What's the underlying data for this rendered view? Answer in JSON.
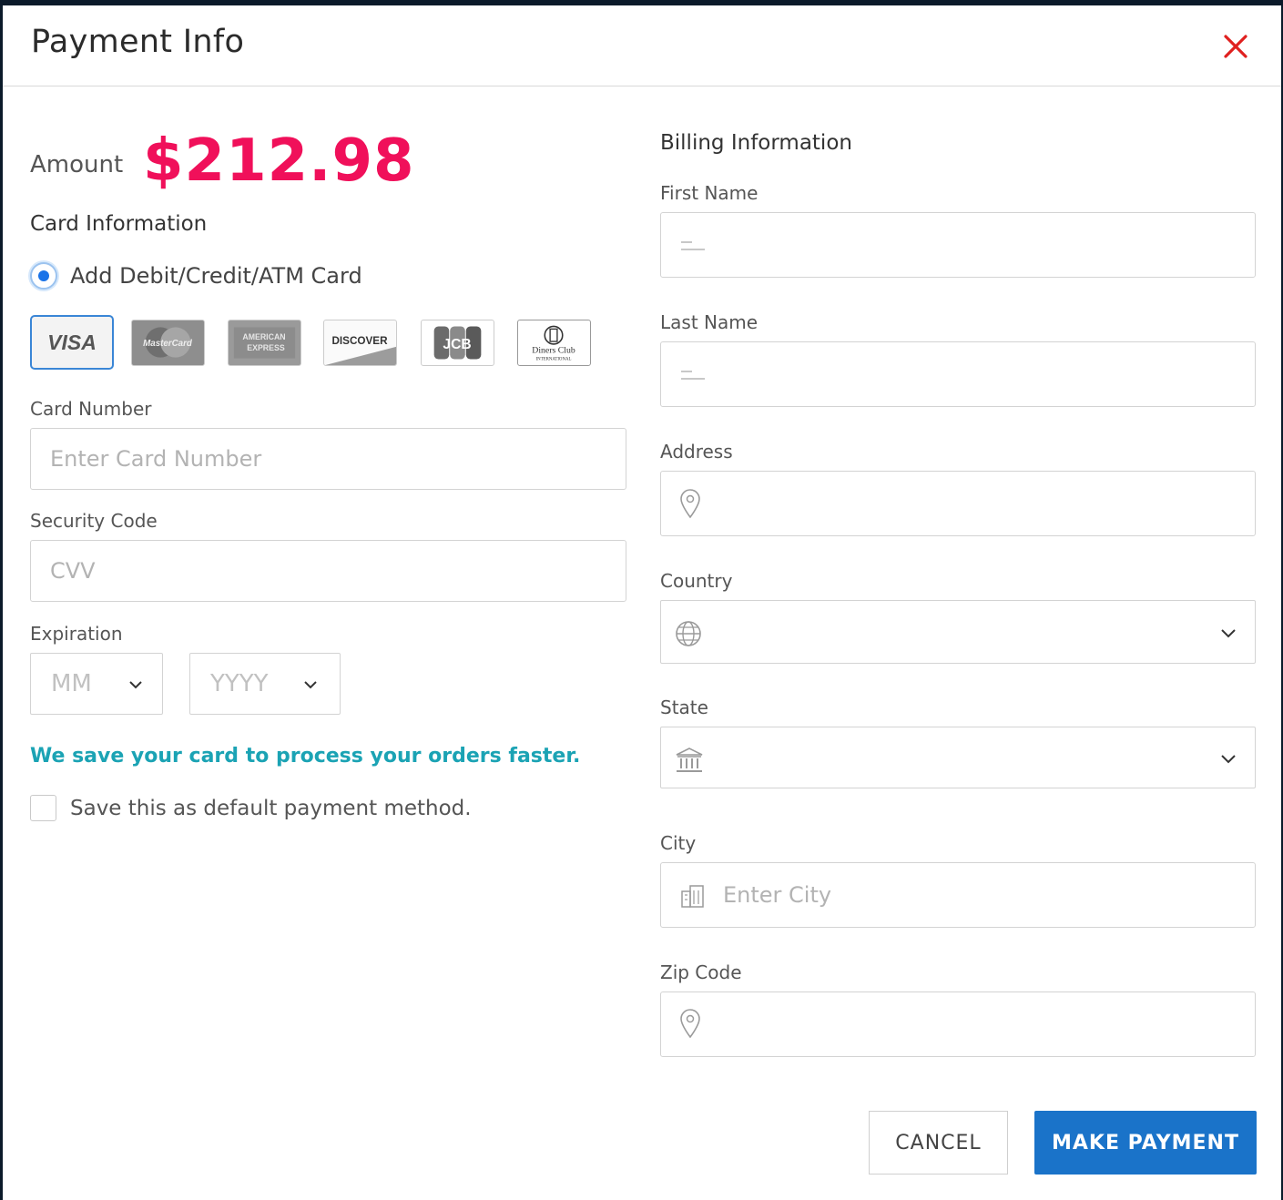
{
  "modal": {
    "title": "Payment Info",
    "close_icon": "close-icon",
    "accent_color": "#f0105a",
    "primary_color": "#1a73c9",
    "note_color": "#1ba3b4"
  },
  "amount": {
    "label": "Amount",
    "value": "$212.98"
  },
  "card_info": {
    "section_title": "Card Information",
    "radio_label": "Add Debit/Credit/ATM Card",
    "radio_selected": true,
    "brands": [
      {
        "name": "VISA",
        "icon": "visa-logo",
        "selected": true
      },
      {
        "name": "MasterCard",
        "icon": "mastercard-logo",
        "selected": false
      },
      {
        "name": "AMERICAN EXPRESS",
        "icon": "amex-logo",
        "selected": false
      },
      {
        "name": "DISCOVER",
        "icon": "discover-logo",
        "selected": false
      },
      {
        "name": "JCB",
        "icon": "jcb-logo",
        "selected": false
      },
      {
        "name": "Diners Club",
        "icon": "diners-club-logo",
        "selected": false
      }
    ],
    "card_number_label": "Card Number",
    "card_number_placeholder": "Enter Card Number",
    "security_code_label": "Security Code",
    "security_code_placeholder": "CVV",
    "expiration_label": "Expiration",
    "month_placeholder": "MM",
    "year_placeholder": "YYYY",
    "save_note": "We save your card to process your orders faster.",
    "default_checkbox_label": "Save this as default payment method.",
    "default_checked": false
  },
  "billing": {
    "section_title": "Billing Information",
    "first_name_label": "First Name",
    "last_name_label": "Last Name",
    "address_label": "Address",
    "country_label": "Country",
    "state_label": "State",
    "city_label": "City",
    "city_placeholder": "Enter City",
    "zip_label": "Zip Code",
    "icons": {
      "first_name": "person-icon",
      "last_name": "person-icon",
      "address": "location-pin-icon",
      "country": "globe-icon",
      "state": "bank-building-icon",
      "city": "city-building-icon",
      "zip": "location-pin-icon"
    }
  },
  "actions": {
    "cancel_label": "CANCEL",
    "pay_label": "MAKE PAYMENT"
  }
}
